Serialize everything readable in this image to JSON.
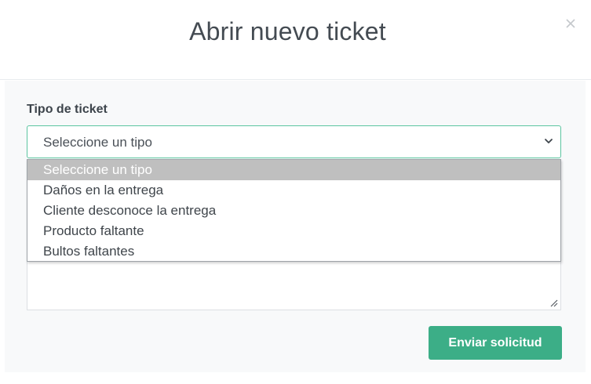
{
  "modal": {
    "title": "Abrir nuevo ticket",
    "close_icon": "close-icon"
  },
  "form": {
    "ticket_type_label": "Tipo de ticket",
    "ticket_type_value": "Seleccione un tipo",
    "ticket_type_options": [
      {
        "label": "Seleccione un tipo",
        "selected": true
      },
      {
        "label": "Daños en la entrega",
        "selected": false
      },
      {
        "label": "Cliente desconoce la entrega",
        "selected": false
      },
      {
        "label": "Producto faltante",
        "selected": false
      },
      {
        "label": "Bultos faltantes",
        "selected": false
      }
    ]
  },
  "footer": {
    "submit_label": "Enviar solicitud"
  },
  "colors": {
    "accent": "#3cae87",
    "focus_border": "#5cc5a0",
    "selected_option_bg": "#bfbfbf"
  }
}
